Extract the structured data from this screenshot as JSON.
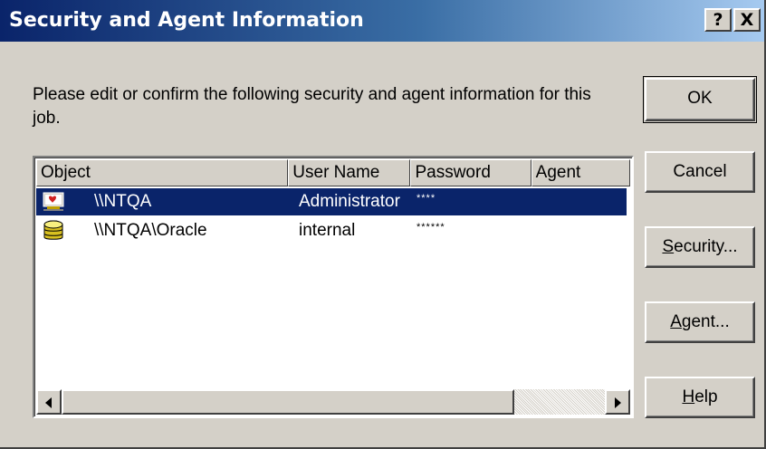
{
  "dialog": {
    "title": "Security and Agent Information",
    "help_glyph": "?",
    "close_glyph": "X",
    "message": "Please edit or confirm the following security and agent information for this job."
  },
  "list": {
    "columns": [
      "Object",
      "User Name",
      "Password",
      "Agent"
    ],
    "rows": [
      {
        "icon": "server-icon",
        "object": "\\\\NTQA",
        "user": "Administrator",
        "password": "****",
        "agent": "",
        "selected": true
      },
      {
        "icon": "database-icon",
        "object": "\\\\NTQA\\Oracle",
        "user": "internal",
        "password": "******",
        "agent": "",
        "selected": false
      }
    ]
  },
  "buttons": {
    "ok": "OK",
    "cancel": "Cancel",
    "security_mnemonic": "S",
    "security_rest": "ecurity...",
    "agent_mnemonic": "A",
    "agent_rest": "gent...",
    "help_mnemonic": "H",
    "help_rest": "elp"
  },
  "colors": {
    "selection": "#0a246a",
    "face": "#d4d0c8",
    "title_start": "#0a246a",
    "title_end": "#a6caf0"
  }
}
